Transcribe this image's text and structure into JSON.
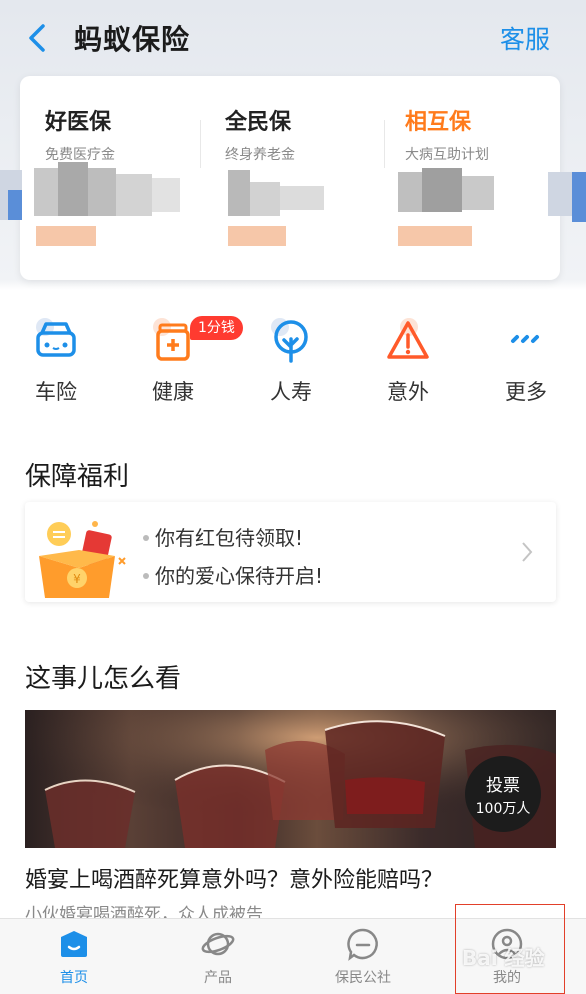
{
  "header": {
    "back_icon": "chevron-left-icon",
    "title": "蚂蚁保险",
    "service_label": "客服"
  },
  "plans": [
    {
      "title": "好医保",
      "subtitle": "免费医疗金"
    },
    {
      "title": "全民保",
      "subtitle": "终身养老金"
    },
    {
      "title": "相互保",
      "subtitle": "大病互助计划"
    }
  ],
  "categories": [
    {
      "label": "车险",
      "icon": "car-icon"
    },
    {
      "label": "健康",
      "icon": "medical-kit-icon"
    },
    {
      "label": "人寿",
      "icon": "tree-icon"
    },
    {
      "label": "意外",
      "icon": "warning-icon"
    },
    {
      "label": "更多",
      "icon": "more-icon"
    }
  ],
  "health_badge": "1分钱",
  "benefits": {
    "title": "保障福利",
    "lines": [
      "你有红包待领取!",
      "你的爱心保待开启!"
    ]
  },
  "discussion": {
    "title": "这事儿怎么看",
    "vote_label": "投票",
    "vote_count": "100万人",
    "article_title": "婚宴上喝酒醉死算意外吗？意外险能赔吗？",
    "article_subtitle": "小伙婚宴喝酒醉死，众人成被告"
  },
  "tabs": [
    {
      "label": "首页",
      "icon": "home-icon",
      "active": true
    },
    {
      "label": "产品",
      "icon": "planet-icon",
      "active": false
    },
    {
      "label": "保民公社",
      "icon": "chat-bubble-icon",
      "active": false
    },
    {
      "label": "我的",
      "icon": "user-icon",
      "active": false
    }
  ],
  "colors": {
    "accent": "#1d8fe8",
    "orange": "#ff7b1c",
    "badge_red": "#ff3b30"
  },
  "watermark": "Bai 经验"
}
